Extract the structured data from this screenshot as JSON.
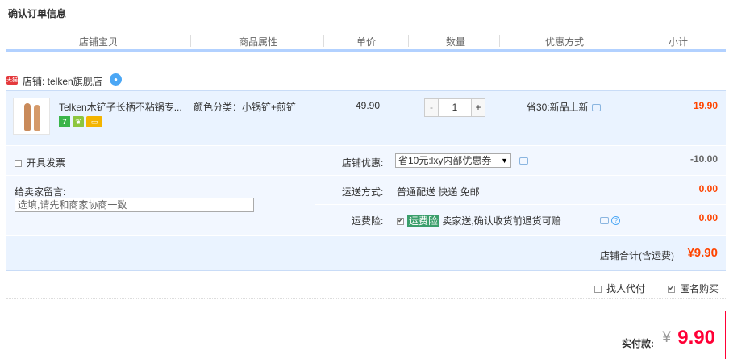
{
  "page_title": "确认订单信息",
  "columns": [
    "店铺宝贝",
    "商品属性",
    "单价",
    "数量",
    "优惠方式",
    "小计"
  ],
  "shop": {
    "badge": "天猫",
    "label": "店铺: telken旗舰店"
  },
  "item": {
    "title": "Telken木铲子长柄不粘锅专...",
    "badges": [
      "7",
      "",
      ""
    ],
    "attribute": "颜色分类：小锅铲+煎铲",
    "price": "49.90",
    "quantity": "1",
    "minus": "-",
    "plus": "+",
    "promotion": "省30:新品上新",
    "subtotal": "19.90"
  },
  "options": {
    "invoice_label": "开具发票",
    "memo_label": "给卖家留言:",
    "memo_value": "选填,请先和商家协商一致",
    "shop_discount_label": "店铺优惠:",
    "shop_discount_selected": "省10元:lxy内部优惠券",
    "shop_discount_amount": "-10.00",
    "shipping_label": "运送方式:",
    "shipping_value": "普通配送 快递 免邮",
    "shipping_amount": "0.00",
    "insurance_label": "运费险:",
    "insurance_tag": "运费险",
    "insurance_desc": "卖家送,确认收货前退货可赔",
    "insurance_amount": "0.00"
  },
  "shop_total": {
    "label": "店铺合计(含运费)",
    "value": "¥9.90"
  },
  "extras": {
    "proxy_pay": "找人代付",
    "anonymous": "匿名购买"
  },
  "payment": {
    "label": "实付款:",
    "currency": "¥",
    "value": "9.90"
  },
  "colors": {
    "accent_red": "#ff0036",
    "price_orange": "#ff4400",
    "header_blue": "#b2d1ff",
    "row_blue": "#eaf3ff"
  }
}
